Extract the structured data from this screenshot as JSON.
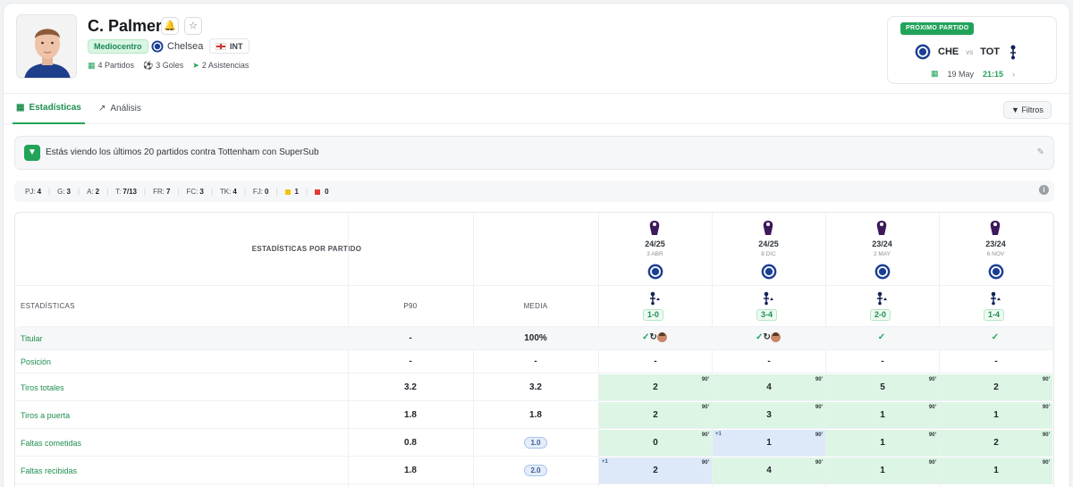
{
  "player": {
    "name": "C. Palmer",
    "position": "Mediocentro",
    "team": "Chelsea",
    "nation": "INT",
    "matches": "4 Partidos",
    "goals": "3 Goles",
    "assists": "2 Asistencias"
  },
  "next_match": {
    "tag": "PRÓXIMO PARTIDO",
    "home": "CHE",
    "vs": "vs",
    "away": "TOT",
    "date": "19 May",
    "time": "21:15"
  },
  "tabs": [
    {
      "label": "Estadísticas",
      "icon": "table-icon",
      "active": true
    },
    {
      "label": "Análisis",
      "icon": "chart-line-icon",
      "active": false
    }
  ],
  "filters_label": "Filtros",
  "banner_text": "Estás viendo los últimos 20 partidos contra Tottenham con SuperSub",
  "summary": [
    {
      "key": "PJ:",
      "value": "4"
    },
    {
      "key": "G:",
      "value": "3"
    },
    {
      "key": "A:",
      "value": "2"
    },
    {
      "key": "T:",
      "value": "7/13"
    },
    {
      "key": "FR:",
      "value": "7"
    },
    {
      "key": "FC:",
      "value": "3"
    },
    {
      "key": "TK:",
      "value": "4"
    },
    {
      "key": "FJ:",
      "value": "0"
    }
  ],
  "cards": {
    "yellow": "1",
    "red": "0"
  },
  "table": {
    "title": "ESTADÍSTICAS POR PARTIDO",
    "col_stats": "ESTADÍSTICAS",
    "col_p90": "P90",
    "col_media": "MEDIA",
    "matches": [
      {
        "season": "24/25",
        "date": "3 ABR",
        "score": "1-0"
      },
      {
        "season": "24/25",
        "date": "8 DIC",
        "score": "3-4"
      },
      {
        "season": "23/24",
        "date": "2 MAY",
        "score": "2-0"
      },
      {
        "season": "23/24",
        "date": "6 NOV",
        "score": "1-4"
      }
    ],
    "rows": [
      {
        "label": "Titular",
        "p90": "-",
        "media": "100%"
      },
      {
        "label": "Posición",
        "p90": "-",
        "media": "-",
        "cells": [
          "-",
          "-",
          "-",
          "-"
        ]
      },
      {
        "label": "Tiros totales",
        "p90": "3.2",
        "media": "3.2",
        "cells": [
          "2",
          "4",
          "5",
          "2"
        ]
      },
      {
        "label": "Tiros a puerta",
        "p90": "1.8",
        "media": "1.8",
        "cells": [
          "2",
          "3",
          "1",
          "1"
        ]
      },
      {
        "label": "Faltas cometidas",
        "p90": "0.8",
        "media": "1.0",
        "cells": [
          "0",
          "1",
          "1",
          "2"
        ]
      },
      {
        "label": "Faltas recibidas",
        "p90": "1.8",
        "media": "2.0",
        "cells": [
          "2",
          "4",
          "1",
          "1"
        ]
      }
    ],
    "minute": "90'",
    "plus": "+1"
  }
}
